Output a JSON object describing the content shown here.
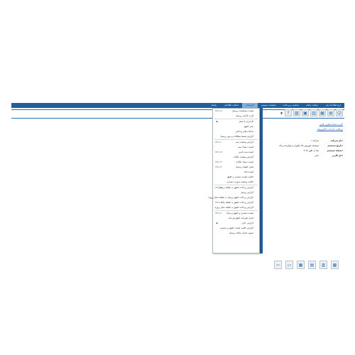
{
  "menubar": {
    "items": [
      {
        "label": "فرم اطلاعات پایه"
      },
      {
        "label": "عملیات ماهانه"
      },
      {
        "label": "محاسبه و پرداخت"
      },
      {
        "label": "تنظیمات سیستم"
      },
      {
        "label": "گزارشات"
      },
      {
        "label": "عملیات اطلاعاتی"
      },
      {
        "label": "راهنما"
      }
    ],
    "active_index": 4
  },
  "links": [
    {
      "label": "کارت ساده طرف قرار"
    },
    {
      "label": "دریافت خدمات الکترونیک"
    }
  ],
  "info": [
    {
      "key": "نام شرکت:",
      "value": "شرکت ۱"
    },
    {
      "key": "تاریخ سیستم:",
      "value": "دوشنبه شهریور ماه یکهزار و چهارصد و یک"
    },
    {
      "key": "نسخه سیستم:",
      "value": "۴.۹۸ بعد از ظهر"
    },
    {
      "key": "نام کاربر:",
      "value": "مدیر"
    }
  ],
  "dropdown": {
    "items": [
      {
        "label": "لیست مشخصات پرسنل",
        "shortcut": "Ctrl+P",
        "arrow": false
      },
      {
        "label": "کارت کارکرد پرسنل",
        "shortcut": "",
        "arrow": false
      },
      {
        "sep": true
      },
      {
        "label": "کارکردی با شمار",
        "shortcut": "",
        "arrow": true
      },
      {
        "label": "دفتر حقوق",
        "shortcut": "",
        "arrow": false
      },
      {
        "label": "ساعات های پرداختی",
        "shortcut": "",
        "arrow": false
      },
      {
        "label": "گزارش قسط مطالبات و دیون پرسنل",
        "shortcut": "",
        "arrow": false
      },
      {
        "sep": true
      },
      {
        "label": "گزارش وضعیت بیمه",
        "shortcut": "Ctrl+I",
        "arrow": false
      },
      {
        "label": "لیست دیسک بیمه",
        "shortcut": "",
        "arrow": false
      },
      {
        "label": "لیست بیمه تامین",
        "shortcut": "Ctrl+S",
        "arrow": false
      },
      {
        "label": "گزارش وضعیت مالیات",
        "shortcut": "",
        "arrow": false
      },
      {
        "label": "لیست دیسک مالیات",
        "shortcut": "Ctrl+T",
        "arrow": false
      },
      {
        "label": "فیش حقوقی پرسنل",
        "shortcut": "Ctrl+F",
        "arrow": false
      },
      {
        "label": "لیست بانک",
        "shortcut": "",
        "arrow": false
      },
      {
        "label": "خلاصه لیست دستمزد و حقوق",
        "shortcut": "",
        "arrow": false
      },
      {
        "label": "خلاصه وضعیت صورت دستمزد",
        "shortcut": "",
        "arrow": false
      },
      {
        "sep": true
      },
      {
        "label": "گزارش پرداخت حقوق به تفکیک پرسنل",
        "shortcut": "Ctrl+G",
        "arrow": false
      },
      {
        "label": "گزارش پرسنل",
        "shortcut": "",
        "arrow": false
      },
      {
        "label": "گزارش پرداخت حقوق پرسنل به تفکیک محل پروژه",
        "shortcut": "",
        "arrow": false
      },
      {
        "label": "گزارش پرداخت حقوق به تفکیک واحد",
        "shortcut": "Ctrl+U",
        "arrow": false
      },
      {
        "label": "گزارش پرداخت حقوق به تفکیک محل پروژه",
        "shortcut": "",
        "arrow": false
      },
      {
        "sep": true
      },
      {
        "label": "لیست دستمزد و حقوق و مزایا",
        "shortcut": "Ctrl+L",
        "arrow": false
      },
      {
        "label": "کنترل تغییرات حقوق هر ماه",
        "shortcut": "",
        "arrow": false
      },
      {
        "label": "گزارش عادی",
        "shortcut": "",
        "arrow": true
      },
      {
        "label": "گزارش خلاصه لیست حقوق و دستمزد",
        "shortcut": "",
        "arrow": false
      },
      {
        "label": "تسویه حساب ماهانه پرسنل",
        "shortcut": "",
        "arrow": false
      }
    ]
  },
  "toolbar": [
    "user-icon",
    "document-icon",
    "report-icon",
    "chart-icon",
    "calendar-icon",
    "print-icon",
    "help-icon"
  ],
  "bottom_icons": [
    "exit-icon",
    "monitor-icon",
    "database-icon",
    "calculator-icon",
    "chart-icon",
    "grid-icon"
  ]
}
